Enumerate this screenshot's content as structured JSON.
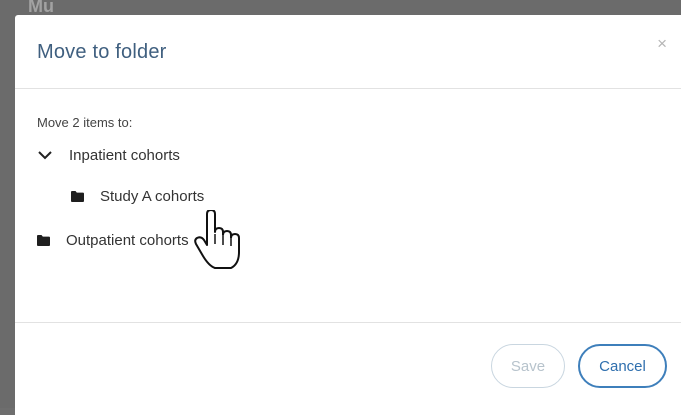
{
  "background": {
    "title": "Mu"
  },
  "modal": {
    "title": "Move to folder",
    "close_icon": "×",
    "prompt": "Move 2 items to:",
    "tree": {
      "inpatient": "Inpatient cohorts",
      "study_a": "Study A cohorts",
      "outpatient": "Outpatient cohorts"
    },
    "buttons": {
      "save": "Save",
      "cancel": "Cancel"
    }
  },
  "colors": {
    "title": "#3f5f7f",
    "accent": "#3e7fbb",
    "disabled": "#c9d6e0"
  },
  "icons": [
    "close-icon",
    "chevron-down-icon",
    "folder-icon",
    "hand-pointer-cursor-icon"
  ]
}
